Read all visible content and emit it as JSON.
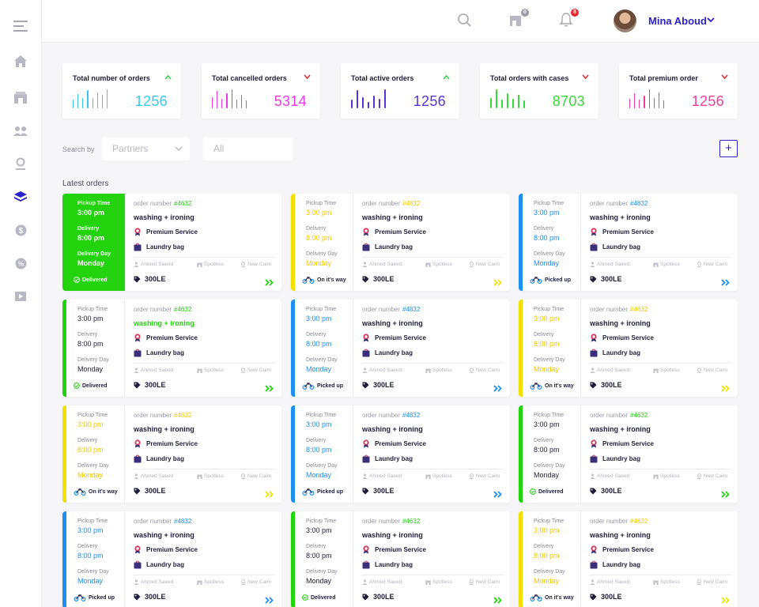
{
  "colors": {
    "accent": "#2a22c8",
    "green": "#22d30e",
    "yellow": "#f2e000",
    "blue": "#1d8ff2",
    "danger": "#e8242c"
  },
  "sidebar": {
    "items": [
      "menu-icon",
      "home-icon",
      "store-icon",
      "users-icon",
      "location-icon",
      "layers-icon",
      "dollar-icon",
      "percent-icon",
      "folder-icon"
    ],
    "active": 5
  },
  "header": {
    "user_name": "Mina Aboud",
    "cart_badge": "0",
    "notif_badge": "8"
  },
  "stats": [
    {
      "label": "Total number of orders",
      "value": "1256",
      "color": "#38c8f2",
      "trend": "up",
      "bars": [
        0.45,
        0.75,
        0.55,
        0.95,
        0.55,
        0.85,
        0.7,
        1.0
      ]
    },
    {
      "label": "Total cancelled orders",
      "value": "5314",
      "color": "#e83ae8",
      "trend": "down",
      "bars": [
        0.6,
        0.9,
        0.5,
        0.8,
        1.0,
        0.45,
        0.7,
        0.4
      ]
    },
    {
      "label": "Total active orders",
      "value": "1256",
      "color": "#5a30d8",
      "trend": "up",
      "bars": [
        0.45,
        0.95,
        0.6,
        0.35,
        0.65,
        0.5,
        1.0,
        0
      ]
    },
    {
      "label": "Total orders with cases",
      "value": "8703",
      "color": "#38d838",
      "trend": "down",
      "bars": [
        0.55,
        1.0,
        0.45,
        0.8,
        0.5,
        0.7,
        0.4,
        0
      ]
    },
    {
      "label": "Total premium order",
      "value": "1256",
      "color": "#f03ca0",
      "trend": "down",
      "bars": [
        0.5,
        0.8,
        0.45,
        0.65,
        1.0,
        0.55,
        0.85,
        0.4
      ]
    }
  ],
  "filters": {
    "search_label": "Search by",
    "partners": "Partners",
    "all": "All"
  },
  "section_title": "Latest orders",
  "labels": {
    "pickup": "Pickup Time",
    "delivery": "Delivery",
    "delivery_day": "Delivery Day",
    "order_number": "order number",
    "premium": "Premium Service",
    "bag": "Laundry bag",
    "customer": "Ahmed Saeed",
    "store": "Spotless",
    "area": "New Cairo"
  },
  "orders": [
    {
      "status": "Delivered",
      "filled": true,
      "service": "washing + ironing",
      "number": "#4632",
      "pickup": "3:00 pm",
      "delivery": "8:00 pm",
      "day": "Monday",
      "price": "300LE"
    },
    {
      "status": "On it's way",
      "service": "washing + ironing",
      "number": "#4832",
      "pickup": "3:00 pm",
      "delivery": "8:00 pm",
      "day": "Monday",
      "price": "300LE"
    },
    {
      "status": "Picked up",
      "service": "washing + ironing",
      "number": "#4832",
      "pickup": "3:00 pm",
      "delivery": "8:00 pm",
      "day": "Monday",
      "price": "300LE"
    },
    {
      "status": "Delivered",
      "service": "washing + ironing",
      "number": "#4632",
      "pickup": "3:00 pm",
      "delivery": "8:00 pm",
      "day": "Monday",
      "price": "300LE",
      "service_colored": true
    },
    {
      "status": "Picked up",
      "service": "washing + ironing",
      "number": "#4832",
      "pickup": "3:00 pm",
      "delivery": "8:00 pm",
      "day": "Monday",
      "price": "300LE"
    },
    {
      "status": "On it's way",
      "service": "washing + ironing",
      "number": "#4632",
      "pickup": "3:00 pm",
      "delivery": "8:00 pm",
      "day": "Monday",
      "price": "300LE"
    },
    {
      "status": "On it's way",
      "service": "washing + ironing",
      "number": "#4632",
      "pickup": "3:00 pm",
      "delivery": "8:00 pm",
      "day": "Monday",
      "price": "300LE"
    },
    {
      "status": "Picked up",
      "service": "washing + ironing",
      "number": "#4832",
      "pickup": "3:00 pm",
      "delivery": "8:00 pm",
      "day": "Monday",
      "price": "300LE"
    },
    {
      "status": "Delivered",
      "service": "washing + ironing",
      "number": "#4632",
      "pickup": "3:00 pm",
      "delivery": "8:00 pm",
      "day": "Monday",
      "price": "300LE",
      "no_price": true
    },
    {
      "status": "Picked up",
      "service": "washing + ironing",
      "number": "#4832",
      "pickup": "3:00 pm",
      "delivery": "8:00 pm",
      "day": "Monday",
      "price": "300LE"
    },
    {
      "status": "Delivered",
      "service": "washing + ironing",
      "number": "#4632",
      "pickup": "3:00 pm",
      "delivery": "8:00 pm",
      "day": "Monday",
      "price": "300LE",
      "plain_times": true
    },
    {
      "status": "On it's way",
      "service": "washing + ironing",
      "number": "#4632",
      "pickup": "3:00 pm",
      "delivery": "8:00 pm",
      "day": "Monday",
      "price": "300LE"
    }
  ]
}
